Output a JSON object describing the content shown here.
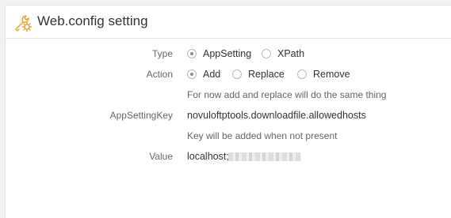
{
  "panel": {
    "title": "Web.config setting",
    "icon": "wrench-gear-icon",
    "accent_color": "#f0a030"
  },
  "form": {
    "type": {
      "label": "Type",
      "options": [
        {
          "label": "AppSetting",
          "checked": true
        },
        {
          "label": "XPath",
          "checked": false
        }
      ]
    },
    "action": {
      "label": "Action",
      "options": [
        {
          "label": "Add",
          "checked": true
        },
        {
          "label": "Replace",
          "checked": false
        },
        {
          "label": "Remove",
          "checked": false
        }
      ],
      "hint": "For now add and replace will do the same thing"
    },
    "app_setting_key": {
      "label": "AppSettingKey",
      "value": "novuloftptools.downloadfile.allowedhosts",
      "hint": "Key will be added when not present"
    },
    "value": {
      "label": "Value",
      "value": "localhost;"
    }
  }
}
